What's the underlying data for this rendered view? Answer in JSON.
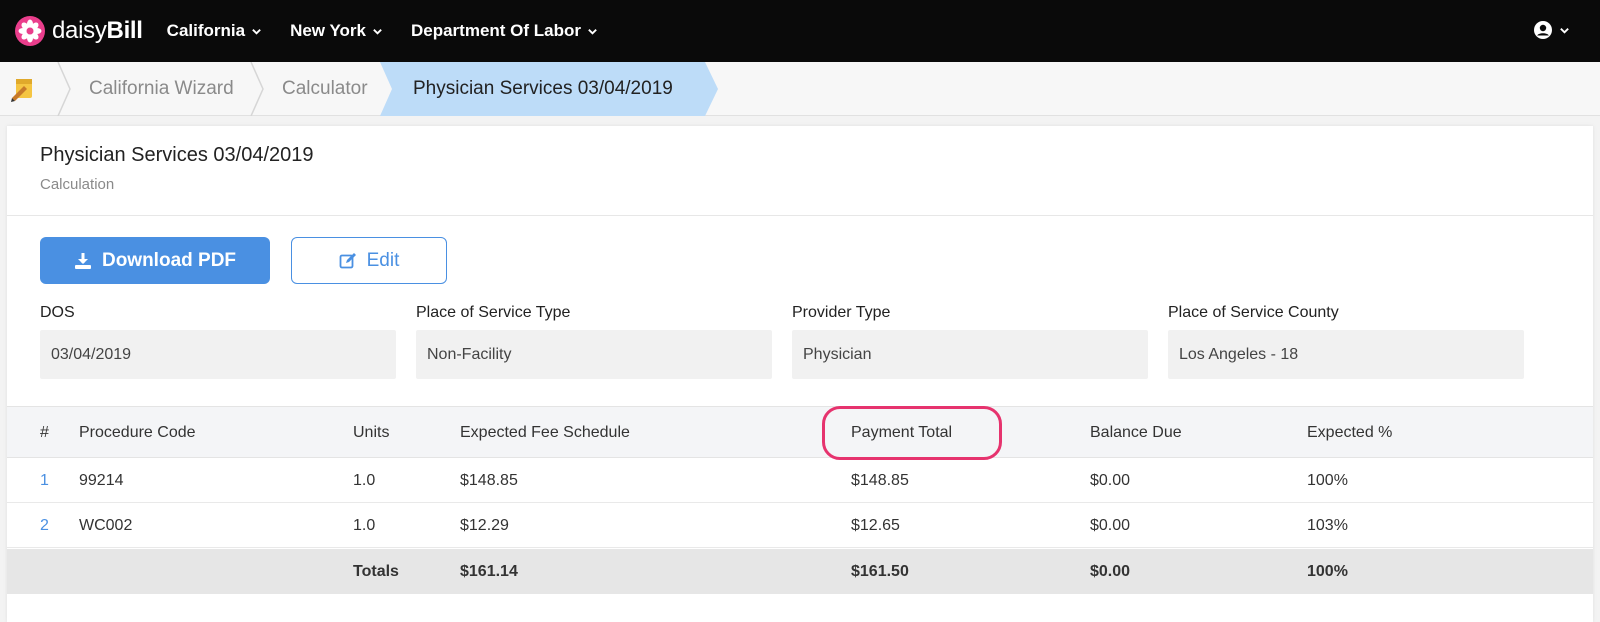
{
  "app": {
    "logo_text_a": "daisy",
    "logo_text_b": "Bill",
    "brand_color": "#ea3e8c"
  },
  "nav": {
    "items": [
      {
        "label": "California"
      },
      {
        "label": "New York"
      },
      {
        "label": "Department Of Labor"
      }
    ],
    "user_icon": "user-circle-icon"
  },
  "breadcrumb": {
    "home_icon": "pencil-note-icon",
    "items": [
      {
        "label": "California Wizard"
      },
      {
        "label": "Calculator"
      }
    ],
    "active": "Physician Services 03/04/2019"
  },
  "card": {
    "title": "Physician Services 03/04/2019",
    "subtitle": "Calculation"
  },
  "actions": {
    "download_label": "Download PDF",
    "edit_label": "Edit",
    "accent": "#4a90e2"
  },
  "fields": [
    {
      "label": "DOS",
      "value": "03/04/2019"
    },
    {
      "label": "Place of Service Type",
      "value": "Non-Facility"
    },
    {
      "label": "Provider Type",
      "value": "Physician"
    },
    {
      "label": "Place of Service County",
      "value": "Los Angeles - 18"
    }
  ],
  "table": {
    "headers": [
      "#",
      "Procedure Code",
      "Units",
      "Expected Fee Schedule",
      "Payment Total",
      "Balance Due",
      "Expected %"
    ],
    "rows": [
      [
        "1",
        "99214",
        "1.0",
        "$148.85",
        "$148.85",
        "$0.00",
        "100%"
      ],
      [
        "2",
        "WC002",
        "1.0",
        "$12.29",
        "$12.65",
        "$0.00",
        "103%"
      ]
    ],
    "totals": [
      "",
      "",
      "Totals",
      "$161.14",
      "$161.50",
      "$0.00",
      "100%"
    ],
    "highlight_color": "#e6336e"
  }
}
